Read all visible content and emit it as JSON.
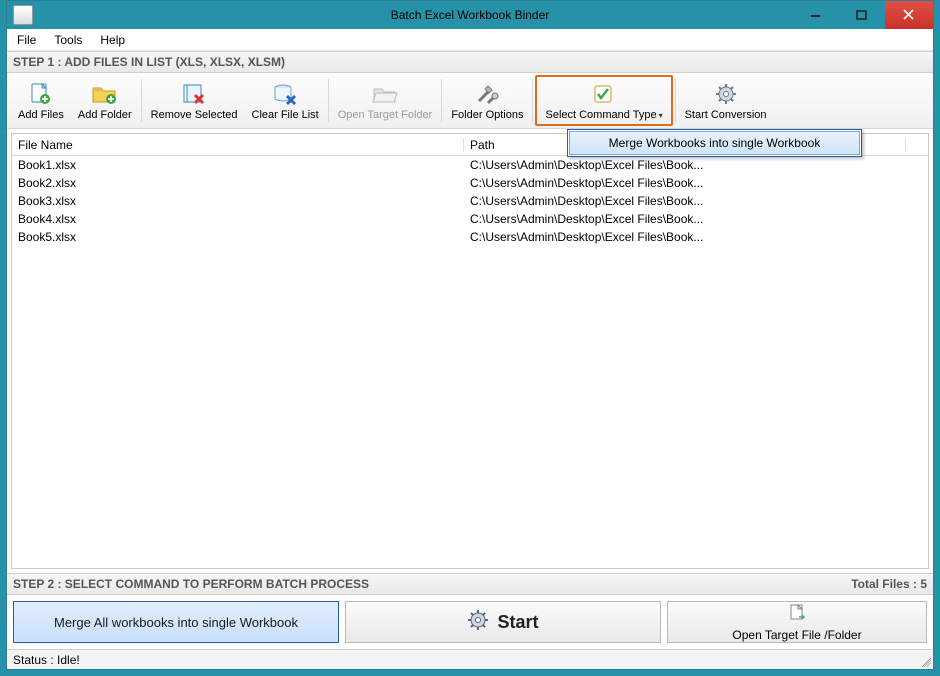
{
  "window": {
    "title": "Batch Excel Workbook Binder"
  },
  "menubar": {
    "items": [
      "File",
      "Tools",
      "Help"
    ]
  },
  "step1": {
    "header": "STEP 1 : ADD FILES IN LIST (XLS, XLSX, XLSM)"
  },
  "toolbar": {
    "add_files": "Add Files",
    "add_folder": "Add Folder",
    "remove_selected": "Remove Selected",
    "clear_file_list": "Clear File List",
    "open_target_folder": "Open Target Folder",
    "folder_options": "Folder Options",
    "select_command_type": "Select Command Type",
    "start_conversion": "Start Conversion"
  },
  "dropdown": {
    "merge_item": "Merge Workbooks into single Workbook"
  },
  "columns": {
    "file_name": "File Name",
    "path": "Path"
  },
  "rows": [
    {
      "file": "Book1.xlsx",
      "path": "C:\\Users\\Admin\\Desktop\\Excel Files\\Book..."
    },
    {
      "file": "Book2.xlsx",
      "path": "C:\\Users\\Admin\\Desktop\\Excel Files\\Book..."
    },
    {
      "file": "Book3.xlsx",
      "path": "C:\\Users\\Admin\\Desktop\\Excel Files\\Book..."
    },
    {
      "file": "Book4.xlsx",
      "path": "C:\\Users\\Admin\\Desktop\\Excel Files\\Book..."
    },
    {
      "file": "Book5.xlsx",
      "path": "C:\\Users\\Admin\\Desktop\\Excel Files\\Book..."
    }
  ],
  "step2": {
    "header": "STEP 2 : SELECT COMMAND TO PERFORM BATCH PROCESS",
    "total_files_label": "Total Files : 5",
    "merge_all_label": "Merge All workbooks into single Workbook",
    "start_label": "Start",
    "open_target_label": "Open Target File /Folder"
  },
  "status": {
    "text": "Status  :  Idle!"
  }
}
